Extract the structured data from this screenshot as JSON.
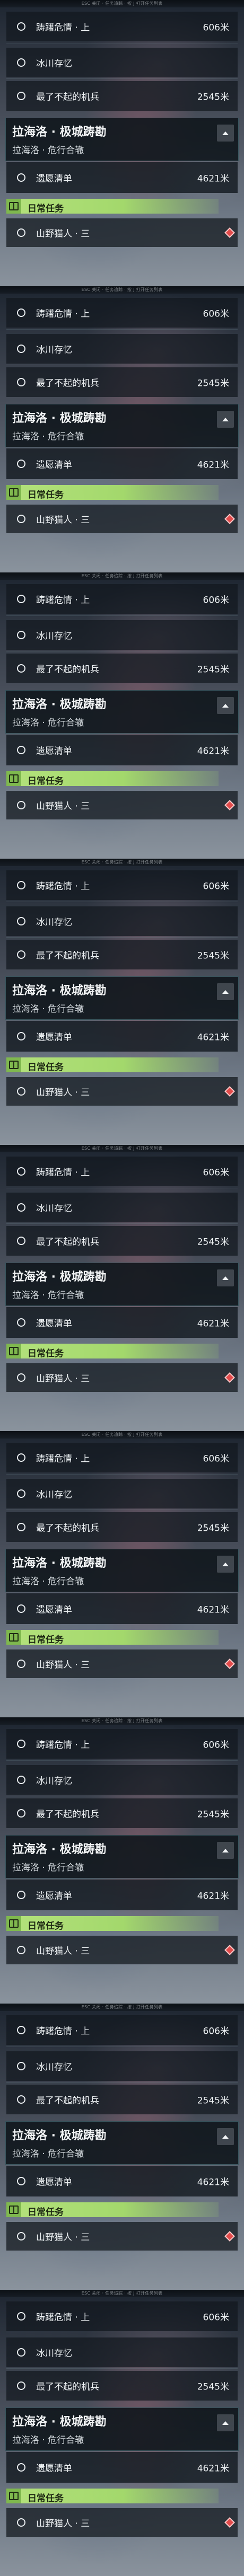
{
  "top_caption": "ESC 关闭 · 任务追踪 · 按 J 打开任务列表",
  "quests": [
    {
      "name": "踌躇危情 · 上",
      "distance": "606米"
    },
    {
      "name": "冰川存忆",
      "distance": ""
    },
    {
      "name": "最了不起的机兵",
      "distance": "2545米"
    }
  ],
  "tracked": {
    "title": "拉海洛 · 极城踌勘",
    "subtitle": "拉海洛 · 危行合辙",
    "sub_quest": {
      "name": "遗愿清单",
      "distance": "4621米"
    }
  },
  "daily": {
    "header": "日常任务",
    "quest": {
      "name": "山野猫人 · 三"
    }
  },
  "colors": {
    "daily_green": "#a3d86c",
    "marker_red": "#e24b4b"
  },
  "icons": [
    "circle-icon",
    "chevron-up-icon",
    "daily-task-icon",
    "diamond-marker-icon"
  ]
}
